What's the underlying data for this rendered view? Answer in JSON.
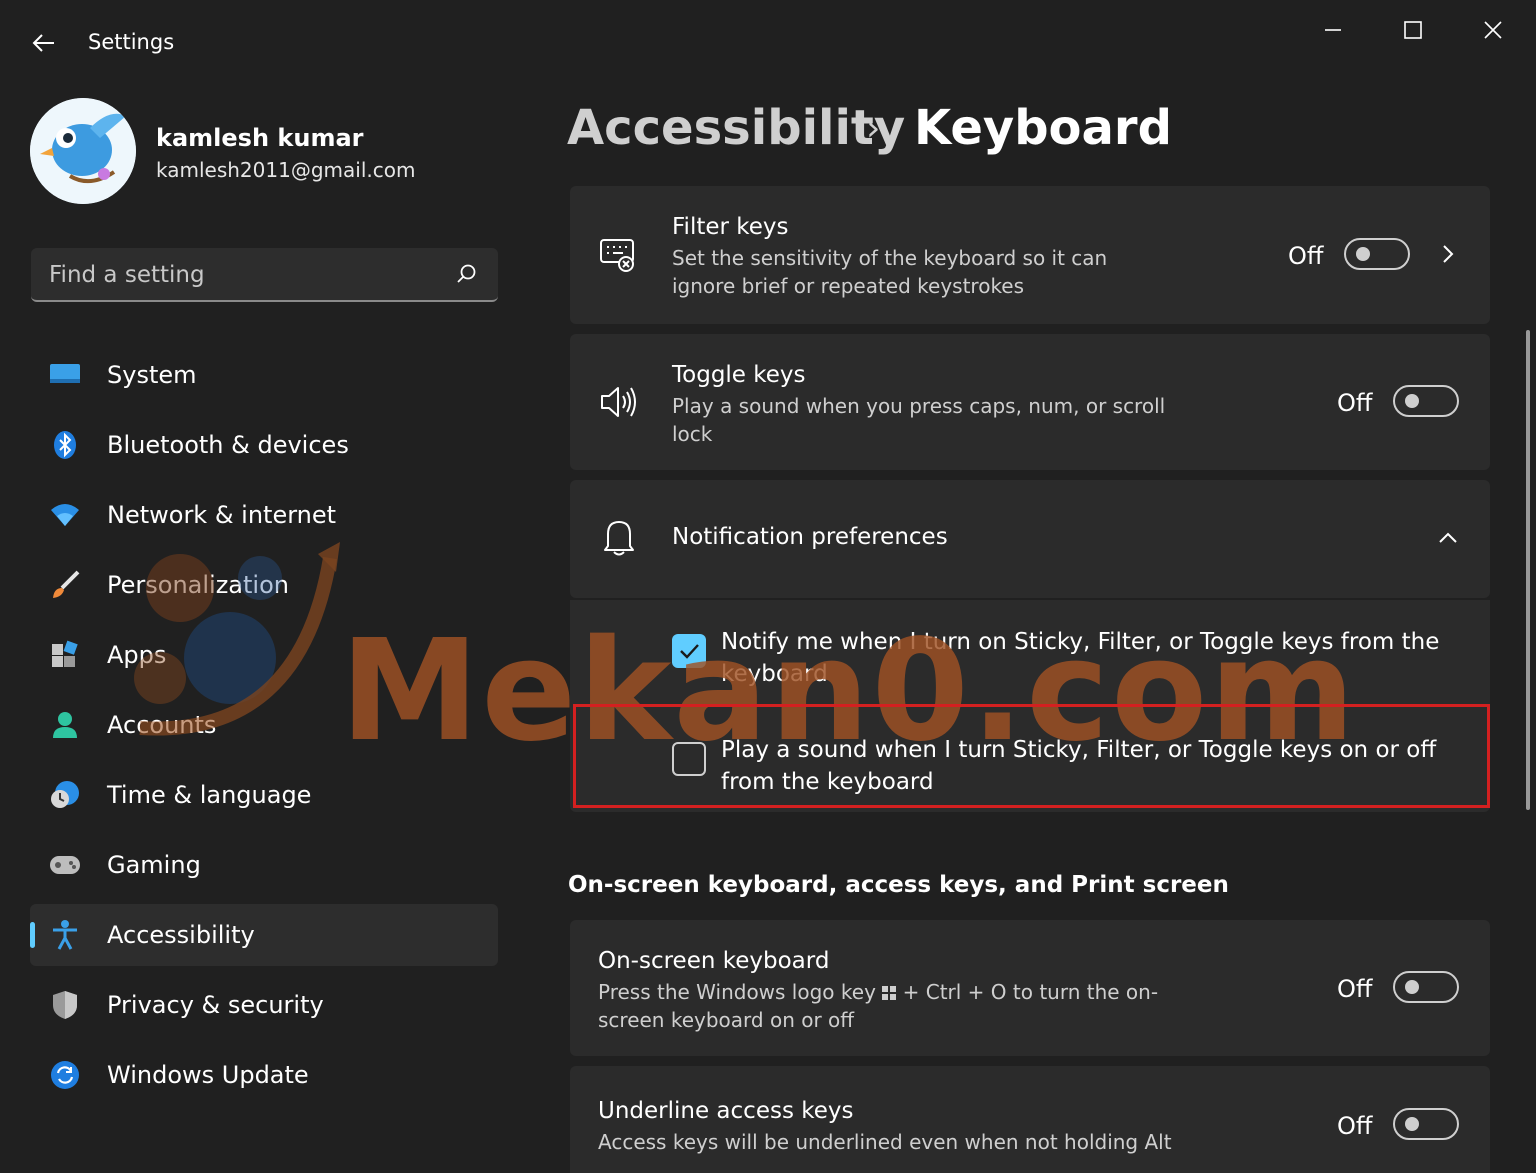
{
  "window": {
    "title": "Settings"
  },
  "user": {
    "name": "kamlesh kumar",
    "email": "kamlesh2011@gmail.com"
  },
  "search": {
    "placeholder": "Find a setting"
  },
  "sidebar": {
    "items": [
      {
        "label": "System",
        "icon": "monitor-icon"
      },
      {
        "label": "Bluetooth & devices",
        "icon": "bluetooth-icon"
      },
      {
        "label": "Network & internet",
        "icon": "wifi-icon"
      },
      {
        "label": "Personalization",
        "icon": "brush-icon"
      },
      {
        "label": "Apps",
        "icon": "apps-icon"
      },
      {
        "label": "Accounts",
        "icon": "person-icon"
      },
      {
        "label": "Time & language",
        "icon": "clock-globe-icon"
      },
      {
        "label": "Gaming",
        "icon": "gamepad-icon"
      },
      {
        "label": "Accessibility",
        "icon": "accessibility-icon",
        "selected": true
      },
      {
        "label": "Privacy & security",
        "icon": "shield-icon"
      },
      {
        "label": "Windows Update",
        "icon": "update-icon"
      }
    ]
  },
  "breadcrumb": {
    "parent": "Accessibility",
    "separator": "›",
    "current": "Keyboard"
  },
  "settings": {
    "filter_keys": {
      "title": "Filter keys",
      "desc_line1": "Set the sensitivity of the keyboard so it can",
      "desc_line2": "ignore brief or repeated keystrokes",
      "state": "Off"
    },
    "toggle_keys": {
      "title": "Toggle keys",
      "desc_line1": "Play a sound when you press caps, num, or scroll",
      "desc_line2": "lock",
      "state": "Off"
    },
    "notification_prefs": {
      "title": "Notification preferences",
      "notify_line1": "Notify me when I turn on Sticky, Filter, or Toggle keys from the",
      "notify_line2": "keyboard",
      "notify_checked": true,
      "sound_line1": "Play a sound when I turn Sticky, Filter, or Toggle keys on or off",
      "sound_line2": "from the keyboard",
      "sound_checked": false
    },
    "section_heading": "On-screen keyboard, access keys, and Print screen",
    "onscreen_keyboard": {
      "title": "On-screen keyboard",
      "desc_part1": "Press the Windows logo key",
      "desc_part2": "+ Ctrl + O to turn the on-",
      "desc_line2": "screen keyboard on or off",
      "state": "Off"
    },
    "underline_access_keys": {
      "title": "Underline access keys",
      "desc": "Access keys will be underlined even when not holding Alt",
      "state": "Off"
    }
  },
  "watermark": {
    "text": "Mekan0.com"
  },
  "colors": {
    "background": "#202020",
    "card": "#2b2b2b",
    "accent": "#60cdff",
    "highlight_box": "#d42020"
  }
}
